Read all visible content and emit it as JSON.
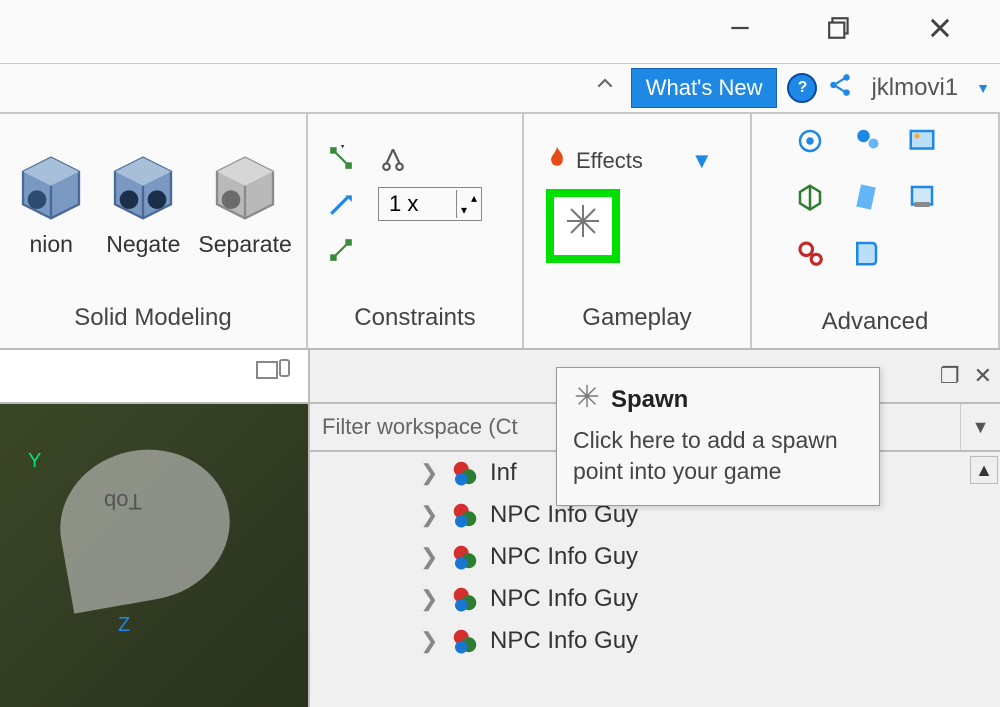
{
  "window": {
    "whats_new": "What's New",
    "username": "jklmovi1"
  },
  "ribbon": {
    "solid_modeling": {
      "label": "Solid Modeling",
      "union": "nion",
      "negate": "Negate",
      "separate": "Separate"
    },
    "constraints": {
      "label": "Constraints",
      "scale_value": "1 x"
    },
    "gameplay": {
      "label": "Gameplay",
      "effects": "Effects"
    },
    "advanced": {
      "label": "Advanced"
    }
  },
  "tooltip": {
    "title": "Spawn",
    "body": "Click here to add a spawn point into your game"
  },
  "explorer": {
    "filter_placeholder": "Filter workspace (Ct",
    "items": [
      "Inf",
      "NPC Info Guy",
      "NPC Info Guy",
      "NPC Info Guy",
      "NPC Info Guy"
    ]
  },
  "viewport": {
    "axis_y": "Y",
    "axis_z": "Z",
    "part_label": "doT"
  }
}
